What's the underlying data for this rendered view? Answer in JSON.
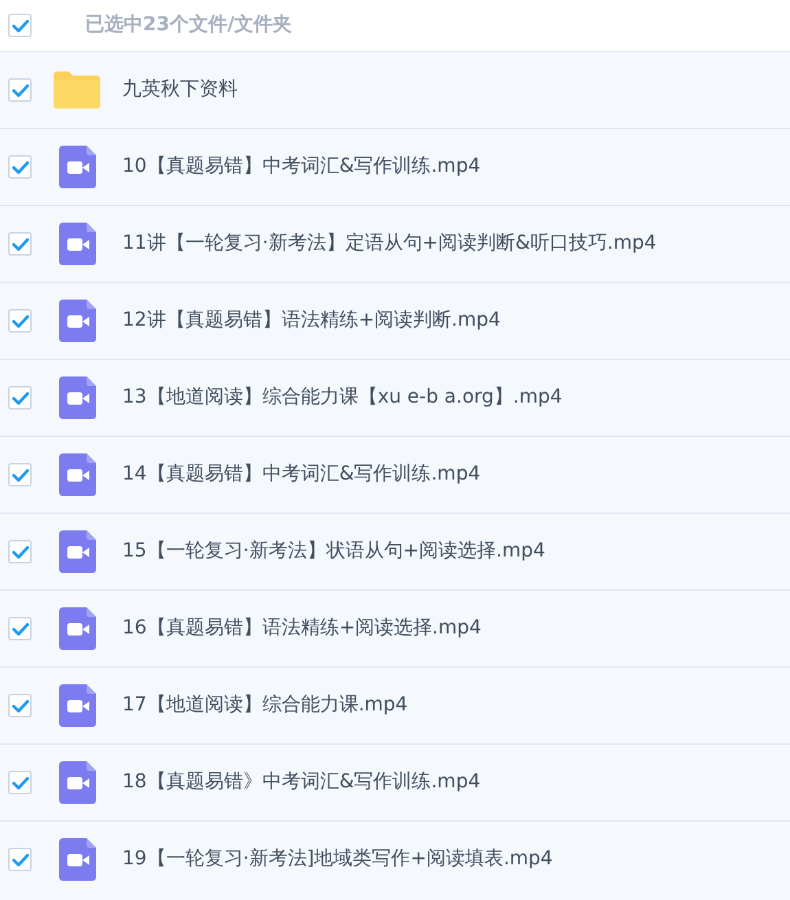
{
  "header": {
    "checked": true,
    "label": "已选中23个文件/文件夹"
  },
  "items": [
    {
      "kind": "folder",
      "name": "九英秋下资料",
      "checked": true
    },
    {
      "kind": "video",
      "name": "10【真题易错】中考词汇&写作训练.mp4",
      "checked": true
    },
    {
      "kind": "video",
      "name": "11讲【一轮复习·新考法】定语从句+阅读判断&听口技巧.mp4",
      "checked": true
    },
    {
      "kind": "video",
      "name": "12讲【真题易错】语法精练+阅读判断.mp4",
      "checked": true
    },
    {
      "kind": "video",
      "name": "13【地道阅读】综合能力课【xu e-b a.org】.mp4",
      "checked": true
    },
    {
      "kind": "video",
      "name": "14【真题易错】中考词汇&写作训练.mp4",
      "checked": true
    },
    {
      "kind": "video",
      "name": "15【一轮复习·新考法】状语从句+阅读选择.mp4",
      "checked": true
    },
    {
      "kind": "video",
      "name": "16【真题易错】语法精练+阅读选择.mp4",
      "checked": true
    },
    {
      "kind": "video",
      "name": "17【地道阅读】综合能力课.mp4",
      "checked": true
    },
    {
      "kind": "video",
      "name": "18【真题易错》中考词汇&写作训练.mp4",
      "checked": true
    },
    {
      "kind": "video",
      "name": "19【一轮复习·新考法]地域类写作+阅读填表.mp4",
      "checked": true
    }
  ]
}
